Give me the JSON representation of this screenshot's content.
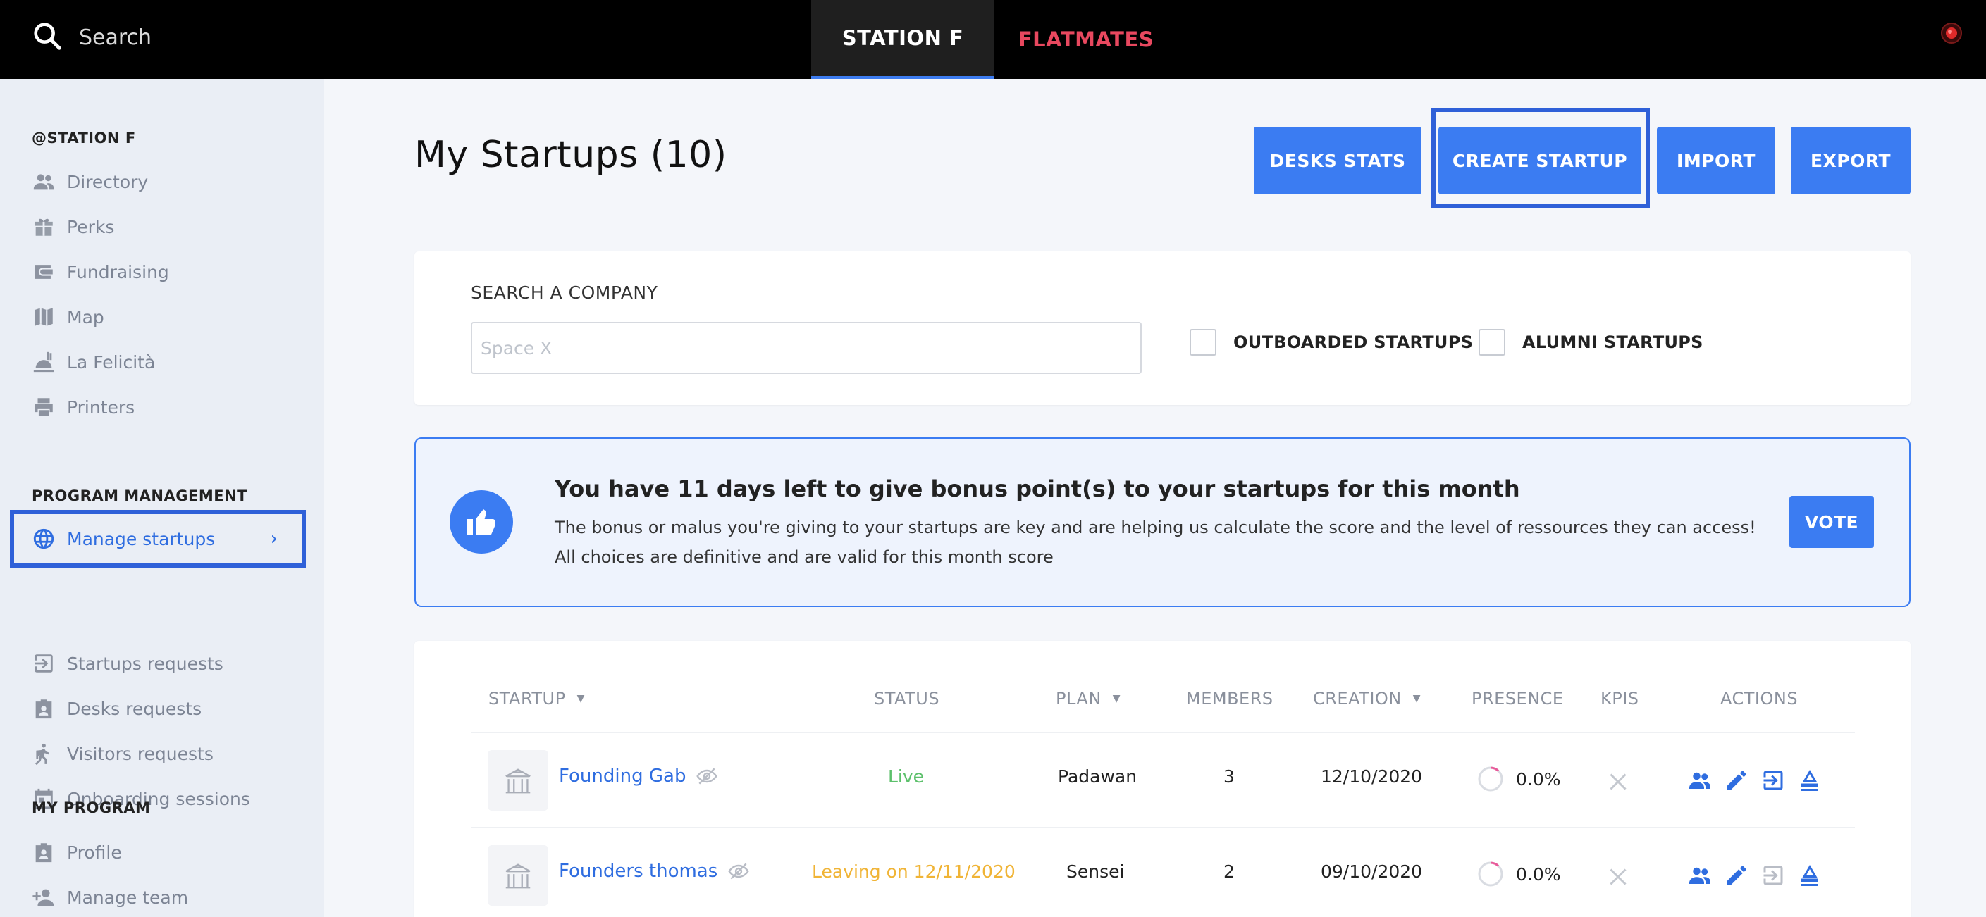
{
  "topbar": {
    "search_placeholder": "Search",
    "tabs": [
      {
        "label": "STATION F"
      },
      {
        "label": "FLATMATES"
      }
    ]
  },
  "sidebar": {
    "sections": [
      {
        "title": "@STATION F",
        "items": [
          {
            "label": "Directory",
            "icon": "people-icon"
          },
          {
            "label": "Perks",
            "icon": "gift-icon"
          },
          {
            "label": "Fundraising",
            "icon": "wallet-icon"
          },
          {
            "label": "Map",
            "icon": "map-icon"
          },
          {
            "label": "La Felicità",
            "icon": "food-icon"
          },
          {
            "label": "Printers",
            "icon": "printer-icon"
          }
        ]
      },
      {
        "title": "PROGRAM MANAGEMENT",
        "items": [
          {
            "label": "Manage startups",
            "icon": "globe-icon",
            "active": true
          },
          {
            "label": "Startups requests",
            "icon": "enter-icon"
          },
          {
            "label": "Desks requests",
            "icon": "badge-icon"
          },
          {
            "label": "Visitors requests",
            "icon": "walking-icon"
          },
          {
            "label": "Onboarding sessions",
            "icon": "calendar-icon"
          }
        ]
      },
      {
        "title": "MY PROGRAM",
        "items": [
          {
            "label": "Profile",
            "icon": "badge-icon"
          },
          {
            "label": "Manage team",
            "icon": "add-person-icon"
          }
        ]
      }
    ]
  },
  "main": {
    "title": "My Startups (10)",
    "buttons": {
      "desks_stats": "DESKS STATS",
      "create_startup": "CREATE STARTUP",
      "import": "IMPORT",
      "export": "EXPORT"
    },
    "search": {
      "label": "SEARCH A COMPANY",
      "placeholder": "Space X",
      "value": "",
      "checkbox_outboarded": "OUTBOARDED STARTUPS",
      "checkbox_alumni": "ALUMNI STARTUPS"
    },
    "vote": {
      "title": "You have 11 days left to give bonus point(s) to your startups for this month",
      "text": "The bonus or malus you're giving to your startups are key and are helping us calculate the score and the level of ressources they can access! All choices are definitive and are valid for this month score",
      "button": "VOTE"
    },
    "table": {
      "headers": {
        "startup": "STARTUP",
        "status": "STATUS",
        "plan": "PLAN",
        "members": "MEMBERS",
        "creation": "CREATION",
        "presence": "PRESENCE",
        "kpis": "KPIS",
        "actions": "ACTIONS"
      },
      "rows": [
        {
          "name": "Founding Gab",
          "status": "Live",
          "plan": "Padawan",
          "members": "3",
          "creation": "12/10/2020",
          "presence": "0.0%"
        },
        {
          "name": "Founders thomas",
          "status": "Leaving on 12/11/2020",
          "plan": "Sensei",
          "members": "2",
          "creation": "09/10/2020",
          "presence": "0.0%"
        }
      ]
    }
  },
  "colors": {
    "accent": "#3b7cf2",
    "flatmates": "#e8485f",
    "live": "#5cc06b",
    "leaving": "#f0b436"
  }
}
